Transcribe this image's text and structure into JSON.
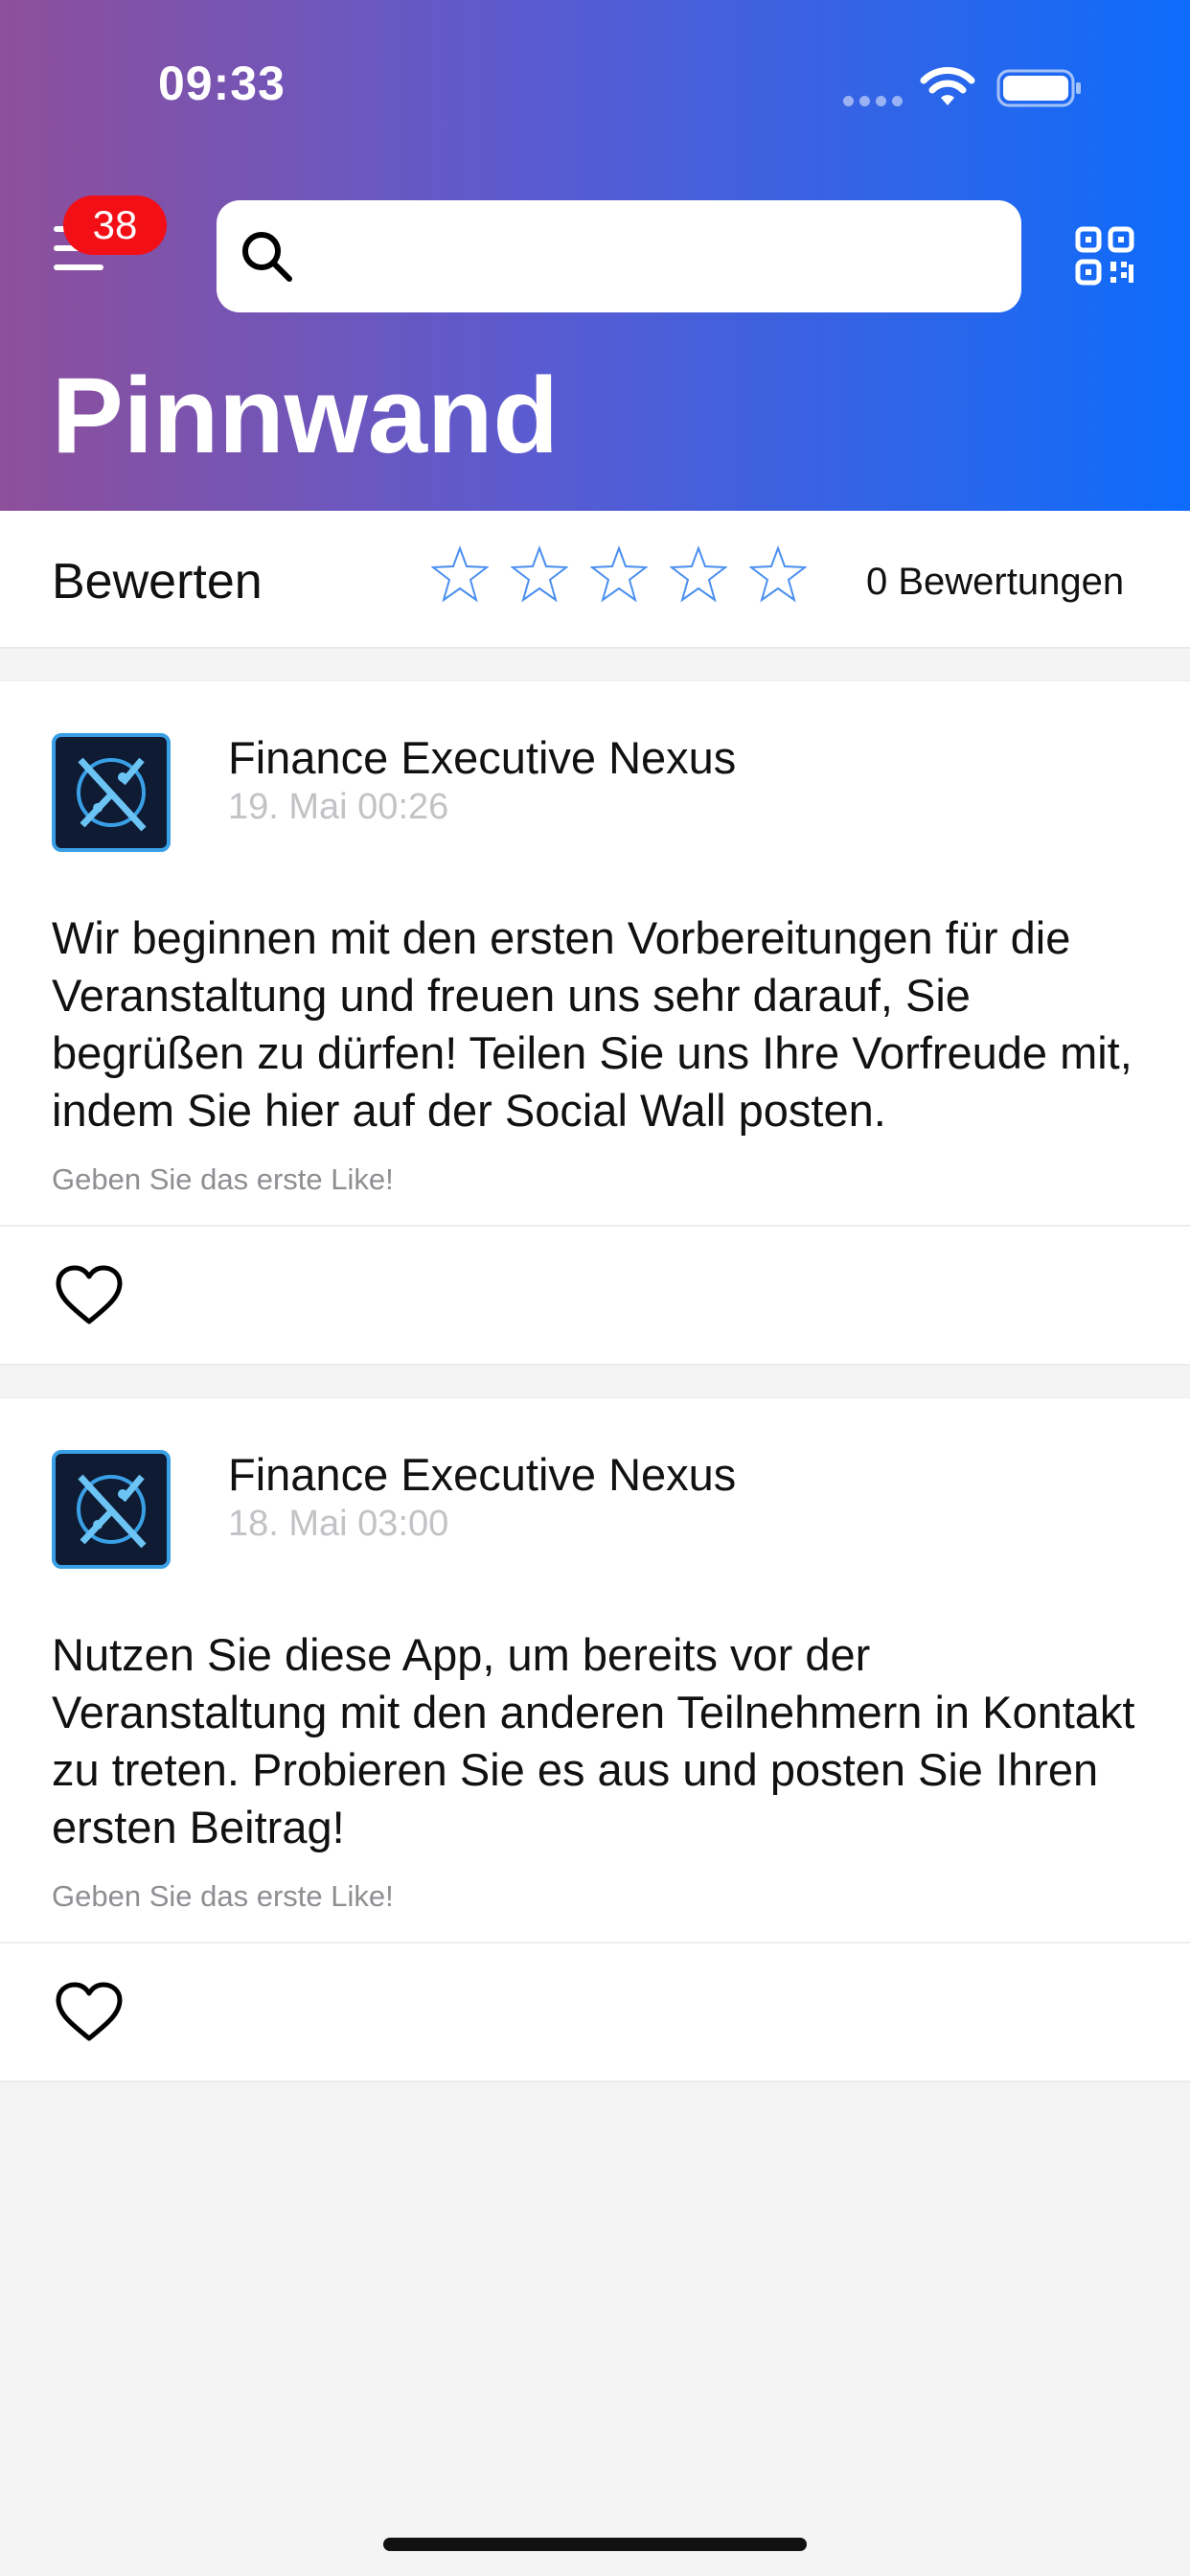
{
  "status_bar": {
    "time": "09:33"
  },
  "header": {
    "notification_count": "38",
    "search_placeholder": "",
    "title": "Pinnwand"
  },
  "rating": {
    "label": "Bewerten",
    "stars_filled": 0,
    "stars_total": 5,
    "count_text": "0 Bewertungen"
  },
  "posts": [
    {
      "author": "Finance Executive Nexus",
      "timestamp": "19. Mai 00:26",
      "text": "Wir beginnen mit den ersten Vorbereitungen für die Veranstaltung und freuen uns sehr darauf, Sie begrüßen zu dürfen! Teilen Sie uns Ihre Vorfreude mit, indem Sie hier auf der Social Wall posten.",
      "like_hint": "Geben Sie das erste Like!"
    },
    {
      "author": "Finance Executive Nexus",
      "timestamp": "18. Mai 03:00",
      "text": "Nutzen Sie diese App, um bereits vor der Veranstaltung mit den anderen Teilnehmern in Kontakt zu treten. Probieren Sie es aus und posten Sie Ihren ersten Beitrag!",
      "like_hint": "Geben Sie das erste Like!"
    }
  ],
  "colors": {
    "gradient_start": "#8e4f9b",
    "gradient_end": "#0d6cfb",
    "badge": "#f30f16",
    "star_outline": "#4a8ff0"
  }
}
